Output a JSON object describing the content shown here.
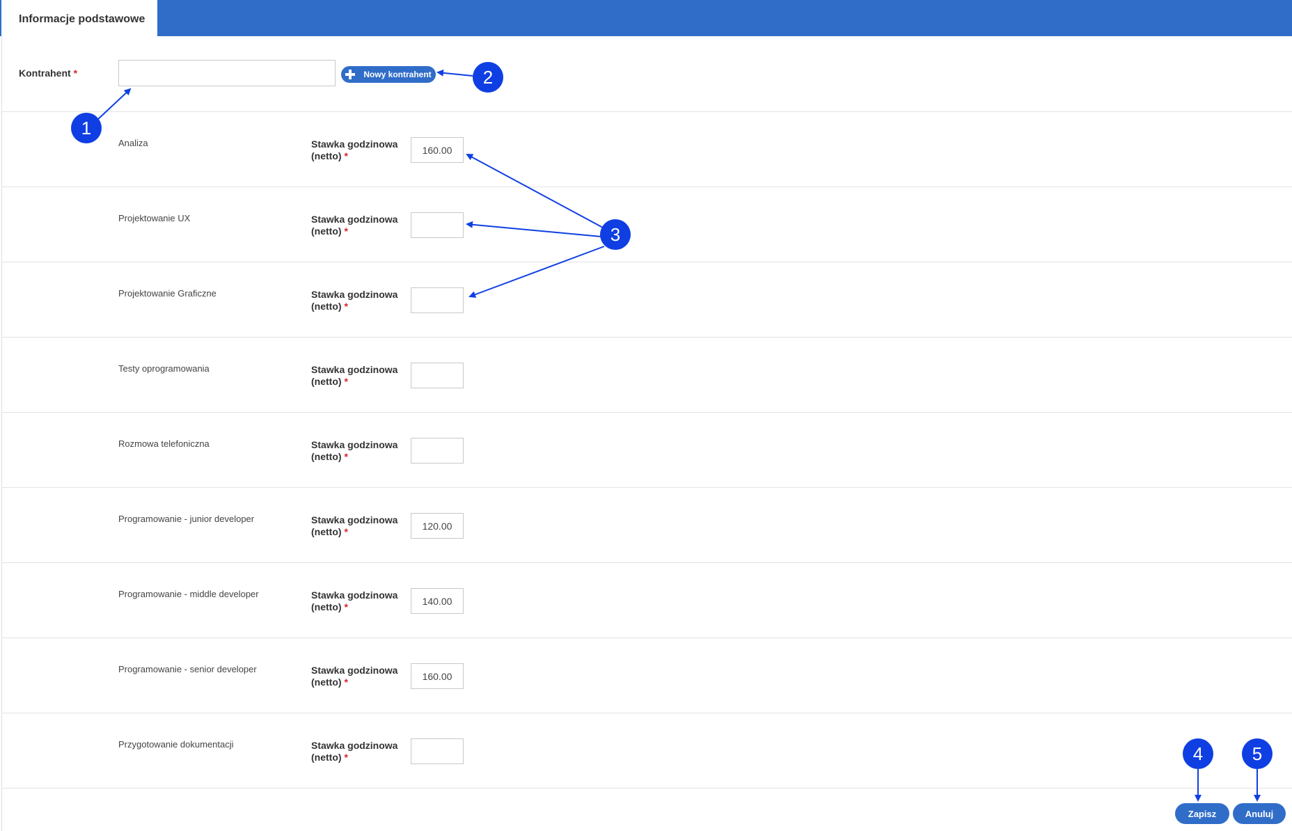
{
  "tab": {
    "label": "Informacje podstawowe"
  },
  "kontrahent": {
    "label": "Kontrahent",
    "required_mark": "*",
    "value": ""
  },
  "new_button": {
    "label": "Nowy kontrahent",
    "icon": "plus-icon"
  },
  "services": [
    {
      "name": "Analiza",
      "rate_label_line1": "Stawka godzinowa",
      "rate_label_line2": "(netto)",
      "required_mark": "*",
      "value": "160.00"
    },
    {
      "name": "Projektowanie UX",
      "rate_label_line1": "Stawka godzinowa",
      "rate_label_line2": "(netto)",
      "required_mark": "*",
      "value": ""
    },
    {
      "name": "Projektowanie Graficzne",
      "rate_label_line1": "Stawka godzinowa",
      "rate_label_line2": "(netto)",
      "required_mark": "*",
      "value": ""
    },
    {
      "name": "Testy oprogramowania",
      "rate_label_line1": "Stawka godzinowa",
      "rate_label_line2": "(netto)",
      "required_mark": "*",
      "value": ""
    },
    {
      "name": "Rozmowa telefoniczna",
      "rate_label_line1": "Stawka godzinowa",
      "rate_label_line2": "(netto)",
      "required_mark": "*",
      "value": ""
    },
    {
      "name": "Programowanie - junior developer",
      "rate_label_line1": "Stawka godzinowa",
      "rate_label_line2": "(netto)",
      "required_mark": "*",
      "value": "120.00"
    },
    {
      "name": "Programowanie - middle developer",
      "rate_label_line1": "Stawka godzinowa",
      "rate_label_line2": "(netto)",
      "required_mark": "*",
      "value": "140.00"
    },
    {
      "name": "Programowanie - senior developer",
      "rate_label_line1": "Stawka godzinowa",
      "rate_label_line2": "(netto)",
      "required_mark": "*",
      "value": "160.00"
    },
    {
      "name": "Przygotowanie dokumentacji",
      "rate_label_line1": "Stawka godzinowa",
      "rate_label_line2": "(netto)",
      "required_mark": "*",
      "value": ""
    }
  ],
  "actions": {
    "save_label": "Zapisz",
    "cancel_label": "Anuluj"
  },
  "callouts": [
    "1",
    "2",
    "3",
    "4",
    "5"
  ],
  "colors": {
    "accent": "#306dc8",
    "callout": "#0f3fe3",
    "required": "#d9232d"
  }
}
